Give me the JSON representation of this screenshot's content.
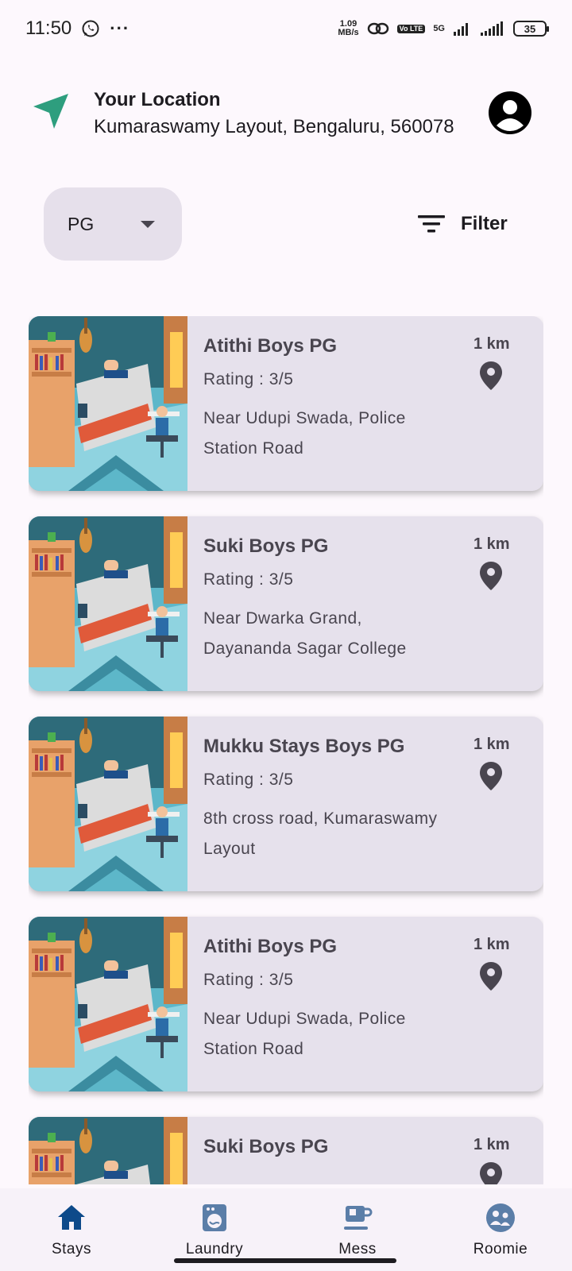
{
  "status_bar": {
    "time": "11:50",
    "more": "···",
    "net_speed_value": "1.09",
    "net_speed_unit": "MB/s",
    "volte": "Vo LTE",
    "network": "5G",
    "battery": "35"
  },
  "location": {
    "title": "Your Location",
    "address": "Kumaraswamy Layout, Bengaluru, 560078",
    "icon": "navigation-arrow-icon",
    "accent": "#2e9e7e"
  },
  "filters": {
    "type_selected": "PG",
    "filter_label": "Filter"
  },
  "listings": [
    {
      "name": "Atithi Boys PG",
      "rating": "Rating : 3/5",
      "address": "Near Udupi Swada, Police Station Road",
      "distance": "1 km"
    },
    {
      "name": "Suki Boys PG",
      "rating": "Rating : 3/5",
      "address": "Near Dwarka Grand, Dayananda Sagar College",
      "distance": "1 km"
    },
    {
      "name": "Mukku Stays Boys PG",
      "rating": "Rating : 3/5",
      "address": "8th cross road, Kumaraswamy Layout",
      "distance": "1 km"
    },
    {
      "name": "Atithi Boys PG",
      "rating": "Rating : 3/5",
      "address": "Near Udupi Swada, Police Station Road",
      "distance": "1 km"
    },
    {
      "name": "Suki Boys PG",
      "rating": "",
      "address": "",
      "distance": "1 km"
    }
  ],
  "nav": {
    "stays": "Stays",
    "laundry": "Laundry",
    "mess": "Mess",
    "roomie": "Roomie",
    "active_color": "#0d4a8a",
    "icon_color": "#5b7ea8"
  }
}
